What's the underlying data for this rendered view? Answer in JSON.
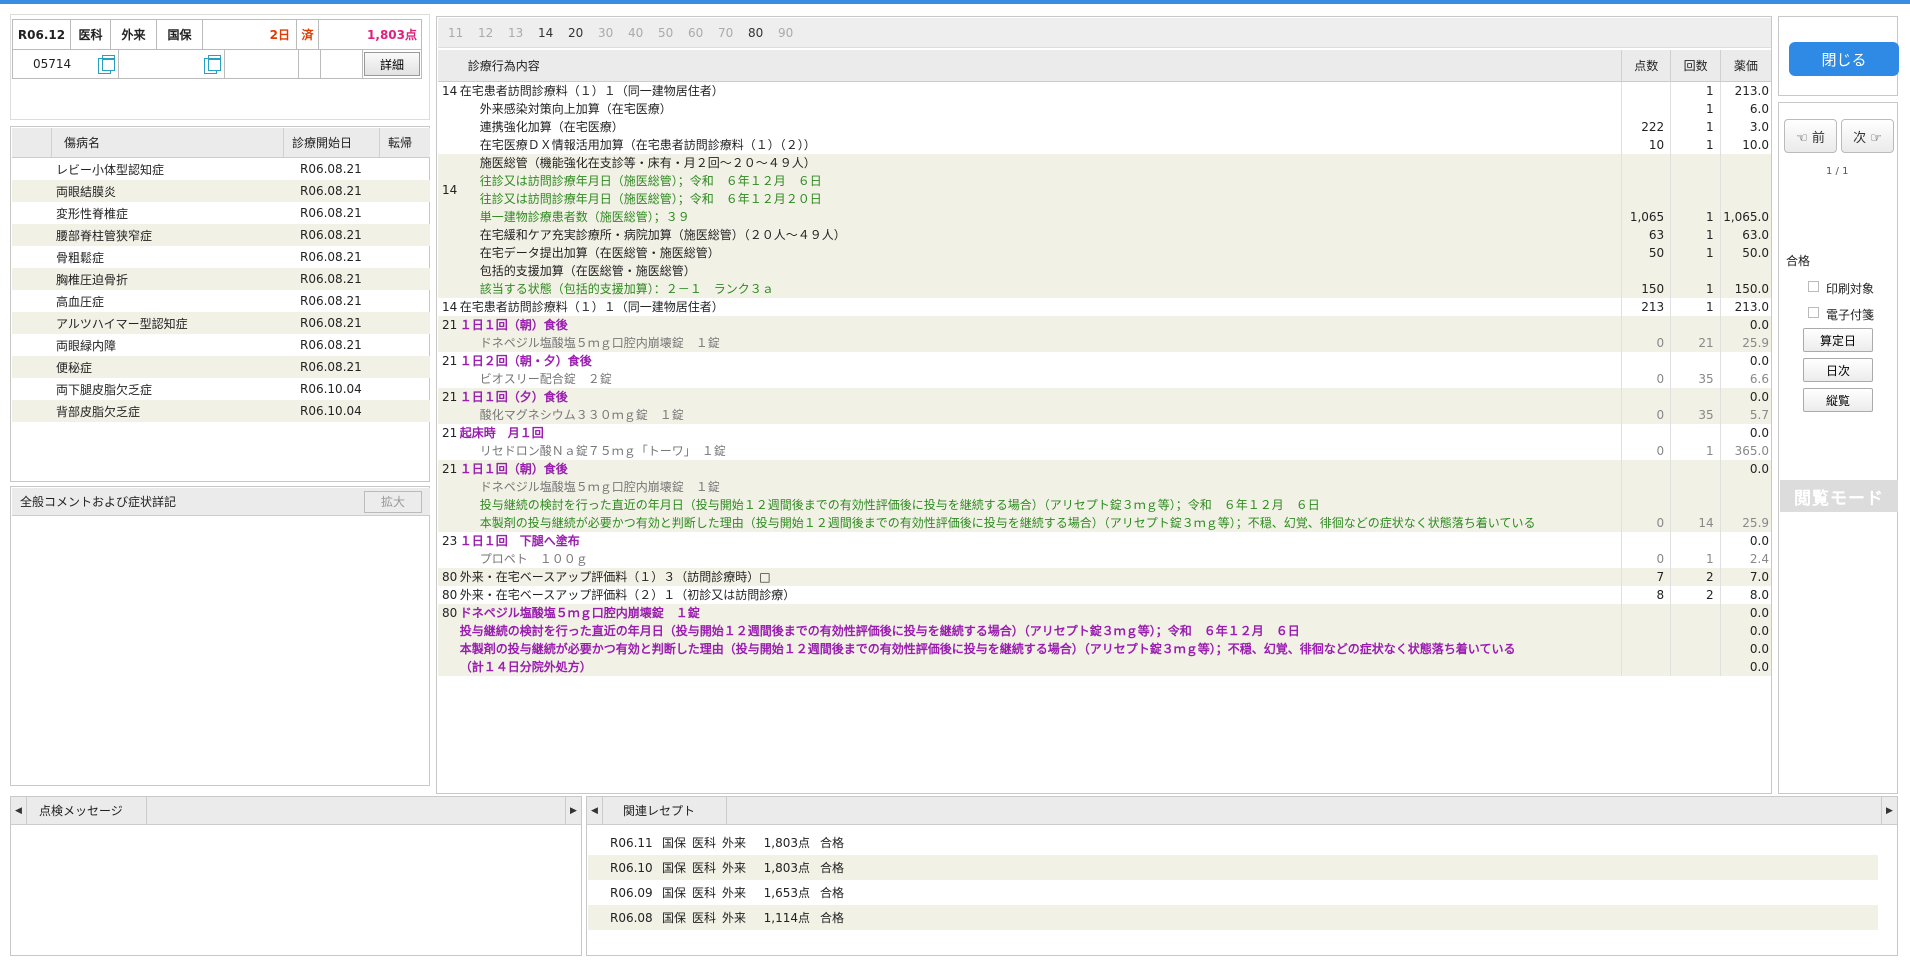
{
  "header": {
    "month": "R06.12",
    "kind": "医科",
    "visit": "外来",
    "insurance": "国保",
    "days": "2日",
    "status": "済",
    "points": "1,803点",
    "patient_id": "05714",
    "detail_label": "詳細"
  },
  "disease": {
    "col_name": "傷病名",
    "col_start": "診療開始日",
    "col_outcome": "転帰",
    "rows": [
      {
        "name": "レビー小体型認知症",
        "date": "R06.08.21"
      },
      {
        "name": "両眼結膜炎",
        "date": "R06.08.21"
      },
      {
        "name": "変形性脊椎症",
        "date": "R06.08.21"
      },
      {
        "name": "腰部脊柱管狭窄症",
        "date": "R06.08.21"
      },
      {
        "name": "骨粗鬆症",
        "date": "R06.08.21"
      },
      {
        "name": "胸椎圧迫骨折",
        "date": "R06.08.21"
      },
      {
        "name": "高血圧症",
        "date": "R06.08.21"
      },
      {
        "name": "アルツハイマー型認知症",
        "date": "R06.08.21"
      },
      {
        "name": "両眼緑内障",
        "date": "R06.08.21"
      },
      {
        "name": "便秘症",
        "date": "R06.08.21"
      },
      {
        "name": "両下腿皮脂欠乏症",
        "date": "R06.10.04"
      },
      {
        "name": "背部皮脂欠乏症",
        "date": "R06.10.04"
      }
    ]
  },
  "comment": {
    "title": "全般コメントおよび症状詳記",
    "expand_label": "拡大"
  },
  "tabs": [
    "11",
    "12",
    "13",
    "14",
    "20",
    "30",
    "40",
    "50",
    "60",
    "70",
    "80",
    "90"
  ],
  "treat_header": {
    "content": "診療行為内容",
    "points": "点数",
    "count": "回数",
    "price": "薬価"
  },
  "treatments": [
    {
      "code": "14",
      "lines": [
        {
          "t": "在宅患者訪問診療料（１）１（同一建物居住者）",
          "c": ""
        }
      ],
      "pts": "",
      "cnt": "1",
      "pr": "213.0",
      "shade": false
    },
    {
      "code": "",
      "lines": [
        {
          "t": "外来感染対策向上加算（在宅医療）",
          "c": "ind"
        }
      ],
      "pts": "",
      "cnt": "1",
      "pr": "6.0",
      "shade": false
    },
    {
      "code": "",
      "lines": [
        {
          "t": "連携強化加算（在宅医療）",
          "c": "ind"
        }
      ],
      "pts": "222",
      "cnt": "1",
      "pr": "3.0",
      "shade": false
    },
    {
      "code": "",
      "lines": [
        {
          "t": "在宅医療ＤＸ情報活用加算（在宅患者訪問診療料（１）（２））",
          "c": "ind"
        }
      ],
      "pts": "10",
      "cnt": "1",
      "pr": "10.0",
      "shade": false
    },
    {
      "code": "14",
      "lines": [
        {
          "t": "施医総管（機能強化在支診等・床有・月２回～２０～４９人）",
          "c": "ind"
        },
        {
          "t": "往診又は訪問診療年月日（施医総管）；令和　６年１２月　６日",
          "c": "ind c-green"
        },
        {
          "t": "往診又は訪問診療年月日（施医総管）；令和　６年１２月２０日",
          "c": "ind c-green"
        },
        {
          "t": "単一建物診療患者数（施医総管）；３９",
          "c": "ind c-green"
        }
      ],
      "pts": "1,065",
      "cnt": "1",
      "pr": "1,065.0",
      "shade": true
    },
    {
      "code": "",
      "lines": [
        {
          "t": "在宅緩和ケア充実診療所・病院加算（施医総管）（２０人～４９人）",
          "c": "ind"
        }
      ],
      "pts": "63",
      "cnt": "1",
      "pr": "63.0",
      "shade": true
    },
    {
      "code": "",
      "lines": [
        {
          "t": "在宅データ提出加算（在医総管・施医総管）",
          "c": "ind"
        }
      ],
      "pts": "50",
      "cnt": "1",
      "pr": "50.0",
      "shade": true
    },
    {
      "code": "",
      "lines": [
        {
          "t": "包括的支援加算（在医総管・施医総管）",
          "c": "ind"
        },
        {
          "t": "該当する状態（包括的支援加算）：２－１　ランク３ａ",
          "c": "ind c-green"
        }
      ],
      "pts": "150",
      "cnt": "1",
      "pr": "150.0",
      "shade": true
    },
    {
      "code": "14",
      "lines": [
        {
          "t": "在宅患者訪問診療料（１）１（同一建物居住者）",
          "c": ""
        }
      ],
      "pts": "213",
      "cnt": "1",
      "pr": "213.0",
      "shade": false
    },
    {
      "code": "21",
      "lines": [
        {
          "t": "１日１回（朝）食後",
          "c": "c-purple"
        }
      ],
      "pts": "",
      "cnt": "",
      "pr": "0.0",
      "shade": true
    },
    {
      "code": "",
      "lines": [
        {
          "t": "ドネペジル塩酸塩５ｍｇ口腔内崩壊錠　１錠",
          "c": "ind c-gray"
        }
      ],
      "pts": "0",
      "cnt": "21",
      "pr": "25.9",
      "shade": true,
      "gray": true
    },
    {
      "code": "21",
      "lines": [
        {
          "t": "１日２回（朝・夕）食後",
          "c": "c-purple"
        }
      ],
      "pts": "",
      "cnt": "",
      "pr": "0.0",
      "shade": false
    },
    {
      "code": "",
      "lines": [
        {
          "t": "ビオスリー配合錠　２錠",
          "c": "ind c-gray"
        }
      ],
      "pts": "0",
      "cnt": "35",
      "pr": "6.6",
      "shade": false,
      "gray": true
    },
    {
      "code": "21",
      "lines": [
        {
          "t": "１日１回（夕）食後",
          "c": "c-purple"
        }
      ],
      "pts": "",
      "cnt": "",
      "pr": "0.0",
      "shade": true
    },
    {
      "code": "",
      "lines": [
        {
          "t": "酸化マグネシウム３３０ｍｇ錠　１錠",
          "c": "ind c-gray"
        }
      ],
      "pts": "0",
      "cnt": "35",
      "pr": "5.7",
      "shade": true,
      "gray": true
    },
    {
      "code": "21",
      "lines": [
        {
          "t": "起床時　月１回",
          "c": "c-purple"
        }
      ],
      "pts": "",
      "cnt": "",
      "pr": "0.0",
      "shade": false
    },
    {
      "code": "",
      "lines": [
        {
          "t": "リセドロン酸Ｎａ錠７５ｍｇ「トーワ」　１錠",
          "c": "ind c-gray"
        }
      ],
      "pts": "0",
      "cnt": "1",
      "pr": "365.0",
      "shade": false,
      "gray": true
    },
    {
      "code": "21",
      "lines": [
        {
          "t": "１日１回（朝）食後",
          "c": "c-purple"
        }
      ],
      "pts": "",
      "cnt": "",
      "pr": "0.0",
      "shade": true
    },
    {
      "code": "",
      "lines": [
        {
          "t": "ドネペジル塩酸塩５ｍｇ口腔内崩壊錠　１錠",
          "c": "ind c-gray"
        },
        {
          "t": "投与継続の検討を行った直近の年月日（投与開始１２週間後までの有効性評価後に投与を継続する場合）（アリセプト錠３ｍｇ等）；令和　６年１２月　６日",
          "c": "ind c-green"
        },
        {
          "t": "本製剤の投与継続が必要かつ有効と判断した理由（投与開始１２週間後までの有効性評価後に投与を継続する場合）（アリセプト錠３ｍｇ等）；不穏、幻覚、徘徊などの症状なく状態落ち着いている",
          "c": "ind c-green"
        }
      ],
      "pts": "0",
      "cnt": "14",
      "pr": "25.9",
      "shade": true,
      "gray": true
    },
    {
      "code": "23",
      "lines": [
        {
          "t": "１日１回　下腿へ塗布",
          "c": "c-purple"
        }
      ],
      "pts": "",
      "cnt": "",
      "pr": "0.0",
      "shade": false
    },
    {
      "code": "",
      "lines": [
        {
          "t": "プロペト　１００ｇ",
          "c": "ind c-gray"
        }
      ],
      "pts": "0",
      "cnt": "1",
      "pr": "2.4",
      "shade": false,
      "gray": true
    },
    {
      "code": "80",
      "lines": [
        {
          "t": "外来・在宅ベースアップ評価料（１）３（訪問診療時）□",
          "c": ""
        }
      ],
      "pts": "7",
      "cnt": "2",
      "pr": "7.0",
      "shade": true
    },
    {
      "code": "80",
      "lines": [
        {
          "t": "外来・在宅ベースアップ評価料（２）１（初診又は訪問診療）",
          "c": ""
        }
      ],
      "pts": "8",
      "cnt": "2",
      "pr": "8.0",
      "shade": false
    },
    {
      "code": "80",
      "lines": [
        {
          "t": "ドネペジル塩酸塩５ｍｇ口腔内崩壊錠　１錠",
          "c": "c-purple"
        }
      ],
      "pts": "",
      "cnt": "",
      "pr": "0.0",
      "shade": true
    },
    {
      "code": "",
      "lines": [
        {
          "t": "投与継続の検討を行った直近の年月日（投与開始１２週間後までの有効性評価後に投与を継続する場合）（アリセプト錠３ｍｇ等）；令和　６年１２月　６日",
          "c": "c-purple"
        }
      ],
      "pts": "",
      "cnt": "",
      "pr": "0.0",
      "shade": true
    },
    {
      "code": "",
      "lines": [
        {
          "t": "本製剤の投与継続が必要かつ有効と判断した理由（投与開始１２週間後までの有効性評価後に投与を継続する場合）（アリセプト錠３ｍｇ等）；不穏、幻覚、徘徊などの症状なく状態落ち着いている",
          "c": "c-purple"
        }
      ],
      "pts": "",
      "cnt": "",
      "pr": "0.0",
      "shade": true
    },
    {
      "code": "",
      "lines": [
        {
          "t": "（計１４日分院外処方）",
          "c": "c-purple"
        }
      ],
      "pts": "",
      "cnt": "",
      "pr": "0.0",
      "shade": true
    }
  ],
  "right": {
    "close_label": "閉じる",
    "prev_label": "☜ 前",
    "next_label": "次 ☞",
    "page": "1 / 1",
    "result": "合格",
    "print_target": "印刷対象",
    "e_attach": "電子付箋",
    "calc_day": "算定日",
    "daily": "日次",
    "overview": "縦覧",
    "mode": "閲覧モード"
  },
  "messages": {
    "title": "点検メッセージ"
  },
  "related": {
    "title": "関連レセプト",
    "rows": [
      {
        "month": "R06.11",
        "ins": "国保",
        "kind": "医科",
        "visit": "外来",
        "pts": "1,803点",
        "result": "合格"
      },
      {
        "month": "R06.10",
        "ins": "国保",
        "kind": "医科",
        "visit": "外来",
        "pts": "1,803点",
        "result": "合格"
      },
      {
        "month": "R06.09",
        "ins": "国保",
        "kind": "医科",
        "visit": "外来",
        "pts": "1,653点",
        "result": "合格"
      },
      {
        "month": "R06.08",
        "ins": "国保",
        "kind": "医科",
        "visit": "外来",
        "pts": "1,114点",
        "result": "合格"
      }
    ]
  },
  "colors": {
    "accent": "#2f8ae6",
    "days": "#e03c00",
    "points": "#e0207a",
    "green_note": "#2e8a20",
    "purple_note": "#9a1fb0",
    "shade": "#f2f1e6"
  }
}
